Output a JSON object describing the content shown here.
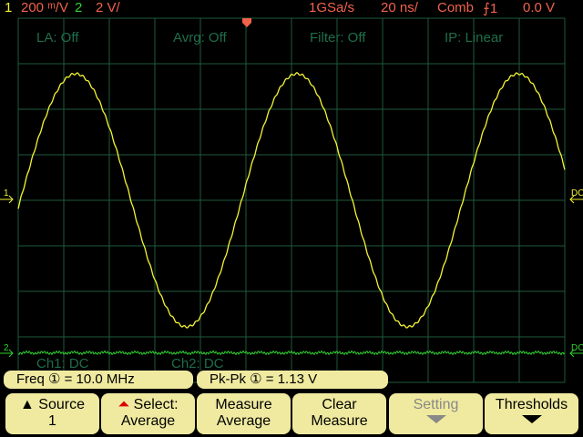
{
  "header": {
    "ch1_num": "1",
    "ch1_scale": "200 ᵐ/V",
    "ch2_num": "2",
    "ch2_scale": "2 V/",
    "sample_rate": "1GSa/s",
    "timebase": "20 ns/",
    "trigger_mode": "Comb",
    "trigger_edge": "⨍1",
    "trigger_level": "0.0 V"
  },
  "overlay": {
    "la": "LA: Off",
    "avrg": "Avrg: Off",
    "filter": "Filter: Off",
    "ip": "IP: Linear",
    "ch1_coupling": "Ch1: DC",
    "ch2_coupling": "Ch2: DC"
  },
  "markers": {
    "ch1": "1",
    "ch2": "2",
    "ch1_right": "DC",
    "ch2_right": "DC"
  },
  "measurements": [
    {
      "text": "Freq ① = 10.0 MHz"
    },
    {
      "text": "Pk-Pk ① =  1.13  V"
    }
  ],
  "softkeys": [
    {
      "line1": "▲ Source",
      "line2": "1"
    },
    {
      "line1": "Select:",
      "line2": "Average"
    },
    {
      "line1": "Measure",
      "line2": "Average"
    },
    {
      "line1": "Clear",
      "line2": "Measure"
    },
    {
      "line1": "Setting",
      "line2": ""
    },
    {
      "line1": "Thresholds",
      "line2": ""
    }
  ],
  "colors": {
    "ch1": "#f5f532",
    "ch2": "#30d030",
    "grid": "#1e5a3a",
    "accent": "#f0624c"
  },
  "signal": {
    "ch1_amplitude_div": 2.78,
    "ch1_period_div": 4.86,
    "ch1_phase_div": 0.045,
    "ch2_offset_div": -3.35
  }
}
